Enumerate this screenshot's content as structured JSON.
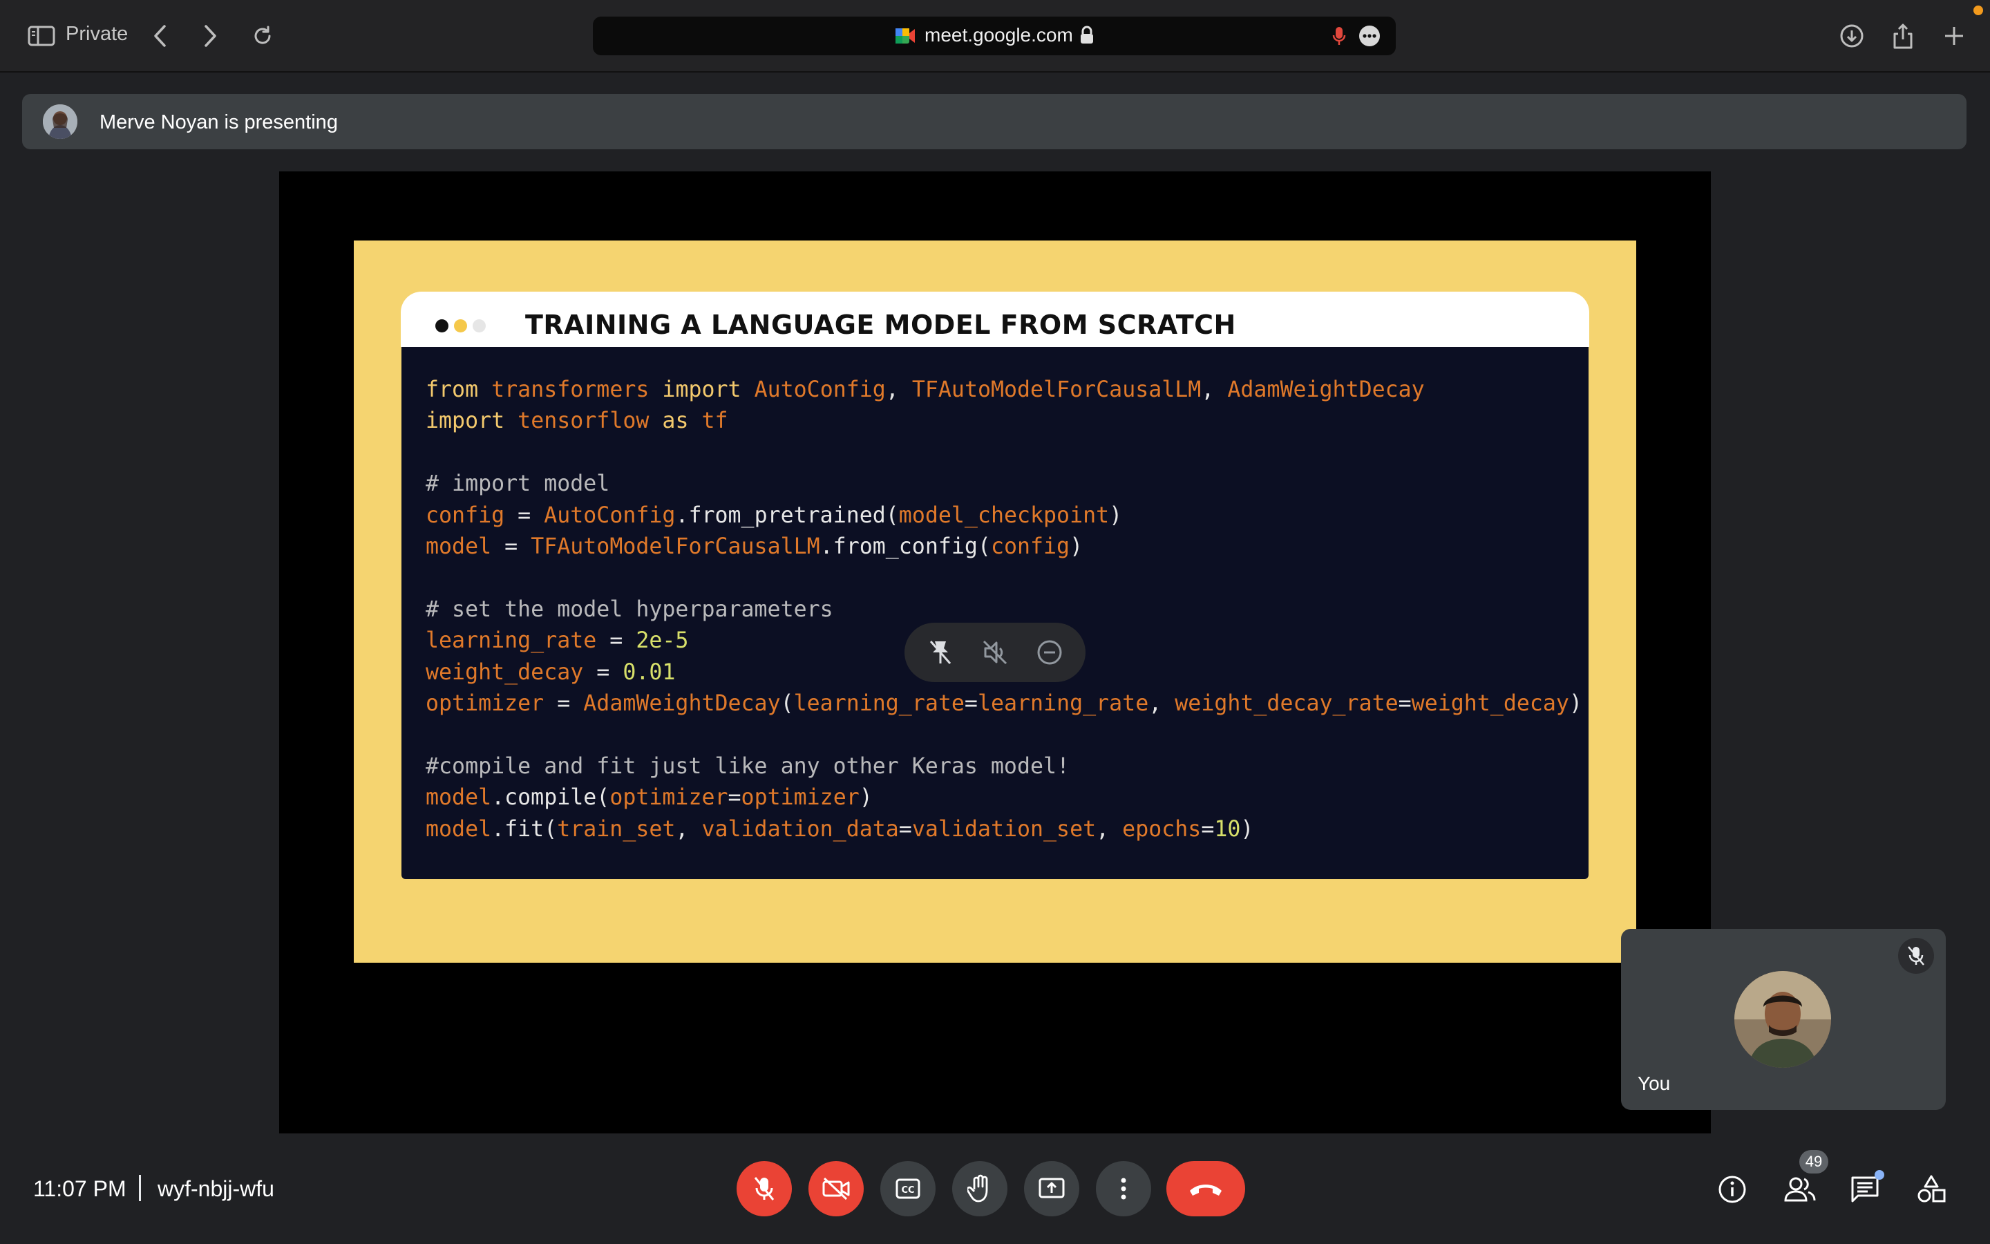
{
  "browser": {
    "mode_label": "Private",
    "url": "meet.google.com"
  },
  "banner": {
    "text": "Merve Noyan is presenting"
  },
  "slide": {
    "title": "TRAINING A LANGUAGE MODEL FROM SCRATCH",
    "dot_colors": [
      "#111111",
      "#f5c84a",
      "#e6e6e6"
    ],
    "code_lines": [
      [
        [
          "kw",
          "from"
        ],
        [
          "pl",
          " "
        ],
        [
          "nm",
          "transformers"
        ],
        [
          "pl",
          " "
        ],
        [
          "kw",
          "import"
        ],
        [
          "pl",
          " "
        ],
        [
          "nm",
          "AutoConfig"
        ],
        [
          "pl",
          ", "
        ],
        [
          "nm",
          "TFAutoModelForCausalLM"
        ],
        [
          "pl",
          ", "
        ],
        [
          "nm",
          "AdamWeightDecay"
        ]
      ],
      [
        [
          "kw",
          "import"
        ],
        [
          "pl",
          " "
        ],
        [
          "nm",
          "tensorflow"
        ],
        [
          "pl",
          " "
        ],
        [
          "kw",
          "as"
        ],
        [
          "pl",
          " "
        ],
        [
          "nm",
          "tf"
        ]
      ],
      [],
      [
        [
          "cm",
          "# import model"
        ]
      ],
      [
        [
          "nm",
          "config"
        ],
        [
          "pl",
          " = "
        ],
        [
          "nm",
          "AutoConfig"
        ],
        [
          "pl",
          ".from_pretrained("
        ],
        [
          "nm",
          "model_checkpoint"
        ],
        [
          "pl",
          ")"
        ]
      ],
      [
        [
          "nm",
          "model"
        ],
        [
          "pl",
          " = "
        ],
        [
          "nm",
          "TFAutoModelForCausalLM"
        ],
        [
          "pl",
          ".from_config("
        ],
        [
          "nm",
          "config"
        ],
        [
          "pl",
          ")"
        ]
      ],
      [],
      [
        [
          "cm",
          "# set the model hyperparameters"
        ]
      ],
      [
        [
          "nm",
          "learning_rate"
        ],
        [
          "pl",
          " = "
        ],
        [
          "num",
          "2e-5"
        ]
      ],
      [
        [
          "nm",
          "weight_decay"
        ],
        [
          "pl",
          " = "
        ],
        [
          "num",
          "0.01"
        ]
      ],
      [
        [
          "nm",
          "optimizer"
        ],
        [
          "pl",
          " = "
        ],
        [
          "nm",
          "AdamWeightDecay"
        ],
        [
          "pl",
          "("
        ],
        [
          "nm",
          "learning_rate"
        ],
        [
          "pl",
          "="
        ],
        [
          "nm",
          "learning_rate"
        ],
        [
          "pl",
          ", "
        ],
        [
          "nm",
          "weight_decay_rate"
        ],
        [
          "pl",
          "="
        ],
        [
          "nm",
          "weight_decay"
        ],
        [
          "pl",
          ")"
        ]
      ],
      [],
      [
        [
          "cm",
          "#compile and fit just like any other Keras model!"
        ]
      ],
      [
        [
          "nm",
          "model"
        ],
        [
          "pl",
          ".compile("
        ],
        [
          "nm",
          "optimizer"
        ],
        [
          "pl",
          "="
        ],
        [
          "nm",
          "optimizer"
        ],
        [
          "pl",
          ")"
        ]
      ],
      [
        [
          "nm",
          "model"
        ],
        [
          "pl",
          ".fit("
        ],
        [
          "nm",
          "train_set"
        ],
        [
          "pl",
          ", "
        ],
        [
          "nm",
          "validation_data"
        ],
        [
          "pl",
          "="
        ],
        [
          "nm",
          "validation_set"
        ],
        [
          "pl",
          ", "
        ],
        [
          "nm",
          "epochs"
        ],
        [
          "pl",
          "="
        ],
        [
          "num",
          "10"
        ],
        [
          "pl",
          ")"
        ]
      ]
    ]
  },
  "self_tile": {
    "name": "You"
  },
  "meeting": {
    "time": "11:07 PM",
    "code": "wyf-nbjj-wfu",
    "participants_count": "49"
  },
  "colors": {
    "accent_red": "#ea4335",
    "slide_yellow": "#f5d470",
    "code_bg": "#0c0f23"
  }
}
